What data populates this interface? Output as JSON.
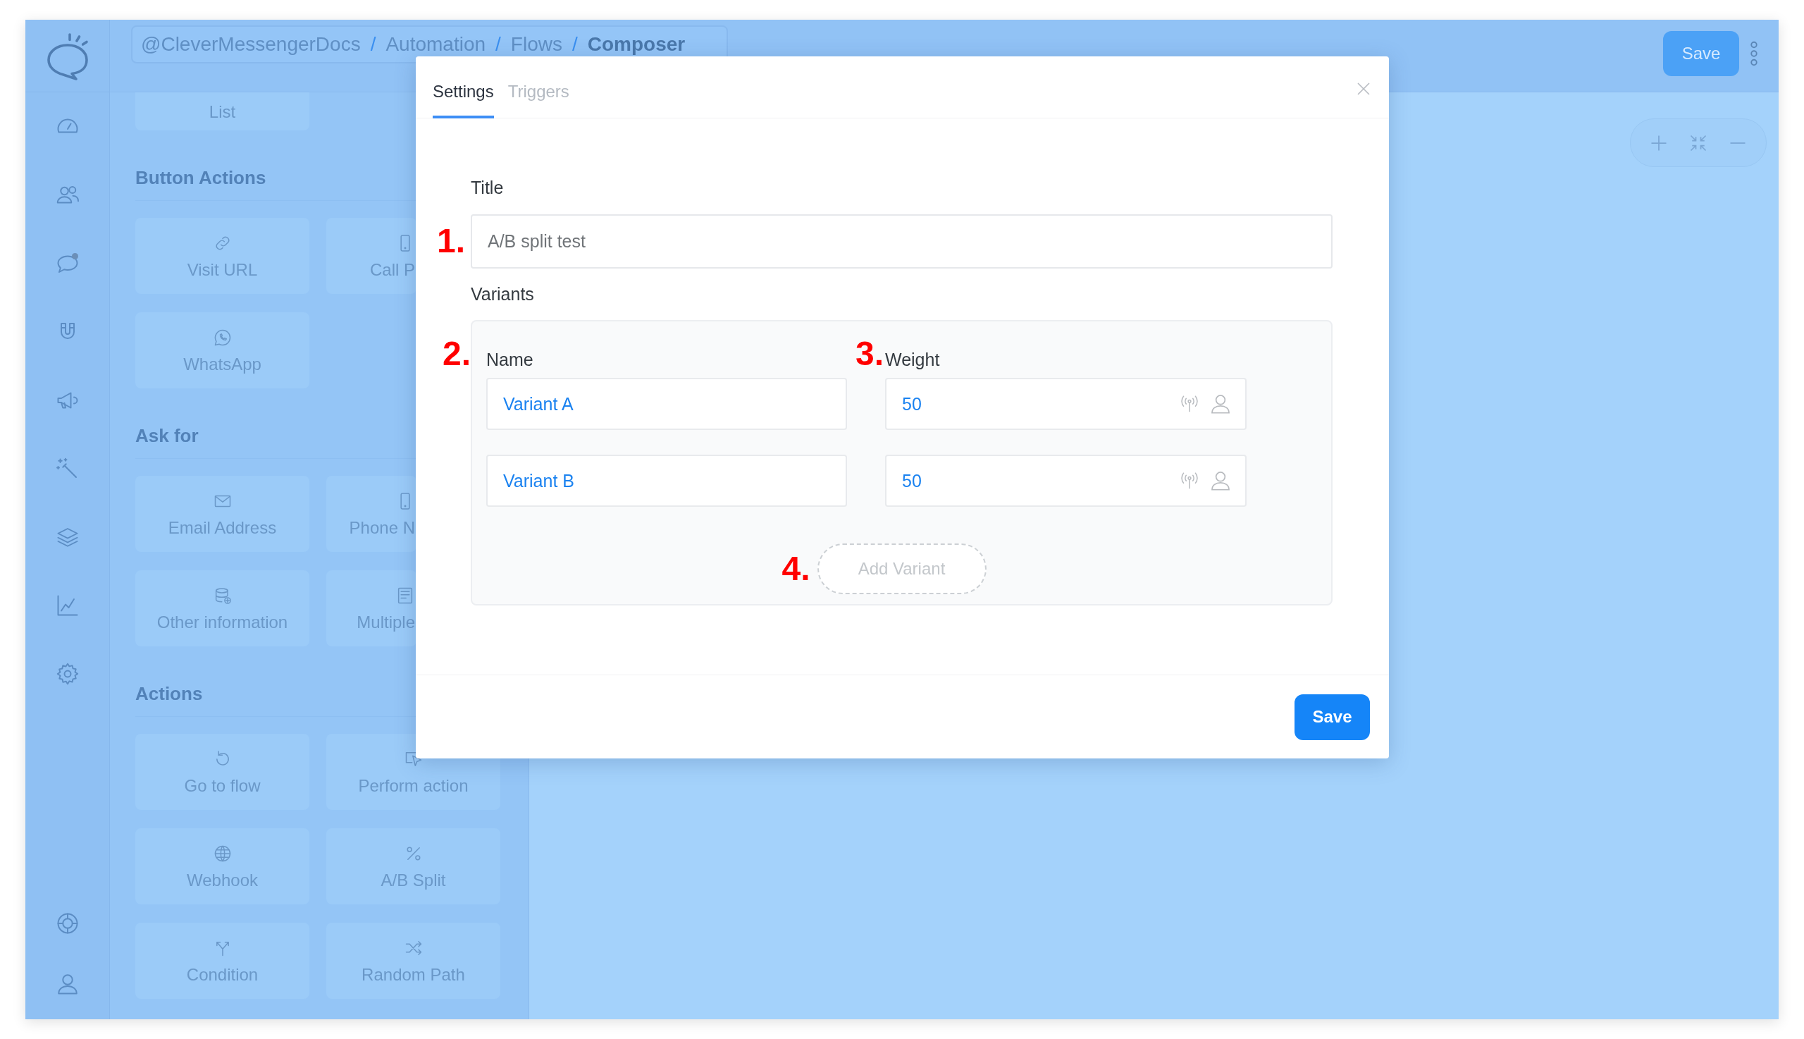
{
  "header": {
    "breadcrumb": [
      {
        "label": "@CleverMessengerDocs",
        "current": false,
        "separator": "/"
      },
      {
        "label": "Automation",
        "current": false,
        "separator": "/"
      },
      {
        "label": "Flows",
        "current": false,
        "separator": "/"
      },
      {
        "label": "Composer",
        "current": true
      }
    ],
    "save_button": "Save"
  },
  "palette": {
    "top_card": "List",
    "sections": [
      {
        "title": "Button Actions",
        "cards": [
          {
            "label": "Visit URL",
            "kind": "full"
          },
          {
            "label": "Call P",
            "kind": "partial"
          },
          {
            "label": "WhatsApp",
            "kind": "full"
          }
        ]
      },
      {
        "title": "Ask for",
        "cards": [
          {
            "label": "Email Address",
            "kind": "full"
          },
          {
            "label": "Phone N",
            "kind": "partial"
          },
          {
            "label": "Other information",
            "kind": "full"
          },
          {
            "label": "Multiple",
            "kind": "partial"
          }
        ]
      },
      {
        "title": "Actions",
        "cards": [
          {
            "label": "Go to flow",
            "kind": "full"
          },
          {
            "label": "Perform action",
            "kind": "full"
          },
          {
            "label": "Webhook",
            "kind": "full"
          },
          {
            "label": "A/B Split",
            "kind": "full"
          },
          {
            "label": "Condition",
            "kind": "full"
          },
          {
            "label": "Random Path",
            "kind": "full"
          }
        ]
      }
    ]
  },
  "modal": {
    "tabs": [
      {
        "label": "Settings",
        "selected": true
      },
      {
        "label": "Triggers",
        "selected": false
      }
    ],
    "title": {
      "label": "Title",
      "value": "A/B split test",
      "marker": "1."
    },
    "variants": {
      "label": "Variants",
      "columns": [
        {
          "label": "Name",
          "marker": "2."
        },
        {
          "label": "Weight",
          "marker": "3."
        }
      ],
      "rows": [
        {
          "name": "Variant A",
          "weight": "50"
        },
        {
          "name": "Variant B",
          "weight": "50"
        }
      ],
      "add_button": {
        "label": "Add Variant",
        "marker": "4."
      }
    },
    "save_button": "Save"
  }
}
